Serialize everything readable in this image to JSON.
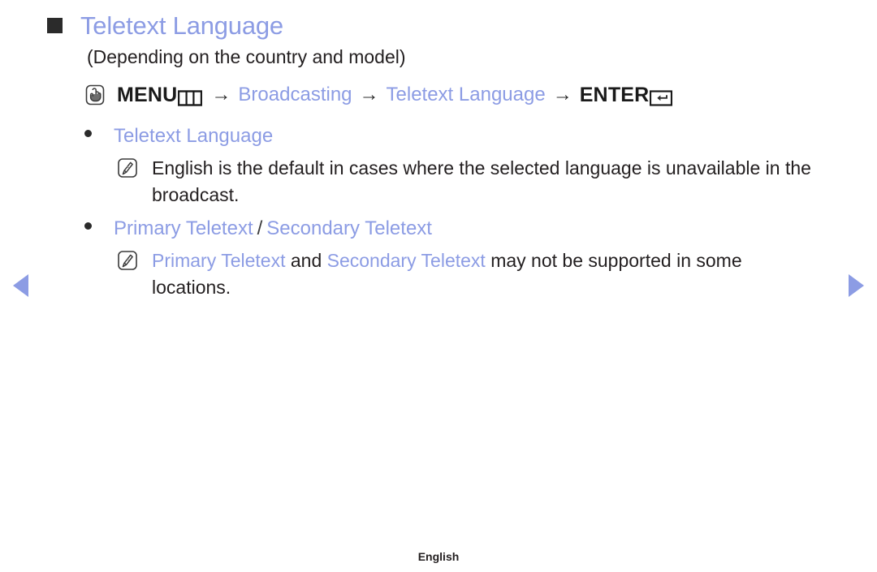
{
  "page": {
    "title": "Teletext Language",
    "subtitle": "(Depending on the country and model)",
    "accent_color": "#8c9ce4",
    "text_color": "#231f20",
    "background_color": "#ffffff"
  },
  "menu_path": {
    "hand_icon": "hand-press-icon",
    "menu_label": "MENU",
    "menu_key_icon": "menu-key-icon",
    "separator": "→",
    "steps": [
      "Broadcasting",
      "Teletext Language"
    ],
    "enter_label": "ENTER",
    "enter_key_icon": "enter-key-icon"
  },
  "options": [
    {
      "name": "Teletext Language",
      "note_icon": "note-pencil-icon",
      "note": {
        "full": "English is the default in cases where the selected language is unavailable in the broadcast.",
        "parts": [
          {
            "text": "English is the default in cases where the selected language is unavailable in the broadcast.",
            "highlight": false
          }
        ]
      }
    },
    {
      "name_parts": [
        {
          "text": "Primary Teletext",
          "highlight": true
        },
        {
          "text": "/",
          "highlight": false
        },
        {
          "text": "Secondary Teletext",
          "highlight": true
        }
      ],
      "note_icon": "note-pencil-icon",
      "note": {
        "full": "Primary Teletext and Secondary Teletext may not be supported in some locations.",
        "parts": [
          {
            "text": "Primary Teletext",
            "highlight": true
          },
          {
            "text": " and ",
            "highlight": false
          },
          {
            "text": "Secondary Teletext",
            "highlight": true
          },
          {
            "text": " may not be supported in some locations.",
            "highlight": false
          }
        ]
      }
    }
  ],
  "navigation": {
    "prev_icon": "previous-page-arrow-icon",
    "next_icon": "next-page-arrow-icon"
  },
  "footer": {
    "language": "English"
  }
}
